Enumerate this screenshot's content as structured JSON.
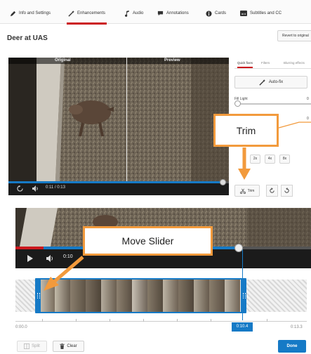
{
  "tabs": [
    {
      "label": "Info and Settings",
      "icon": "pencil-icon"
    },
    {
      "label": "Enhancements",
      "icon": "magic-wand-icon",
      "active": true
    },
    {
      "label": "Audio",
      "icon": "music-note-icon"
    },
    {
      "label": "Annotations",
      "icon": "speech-bubble-icon"
    },
    {
      "label": "Cards",
      "icon": "info-circle-icon"
    },
    {
      "label": "Subtitles and CC",
      "icon": "subtitles-icon"
    }
  ],
  "page": {
    "title": "Deer at UAS",
    "revert_label": "Revert to original"
  },
  "preview": {
    "original_label": "Original",
    "preview_label": "Preview",
    "time": "0:11 / 0:13",
    "progress": 0.97
  },
  "panel": {
    "tabs": [
      "Quick fixes",
      "Filters",
      "Blurring effects"
    ],
    "autofix_label": "Auto-fix",
    "fill_light_label": "Fill Light",
    "fill_light_value": "0",
    "second_value": "0",
    "speed_options": [
      "2x",
      "4x",
      "8x"
    ],
    "trim_label": "Trim"
  },
  "player": {
    "time": "0:10",
    "played_fraction": 0.095,
    "selected_end_fraction": 0.755
  },
  "timeline": {
    "start": "0:00.0",
    "current": "0:10.4",
    "end": "0:13.3"
  },
  "bottom": {
    "split_label": "Split",
    "clear_label": "Clear",
    "done_label": "Done"
  },
  "callouts": {
    "trim": "Trim",
    "slider": "Move Slider"
  },
  "colors": {
    "accent_red": "#cc181e",
    "accent_blue": "#167ac6",
    "callout_orange": "#f29a3c"
  }
}
